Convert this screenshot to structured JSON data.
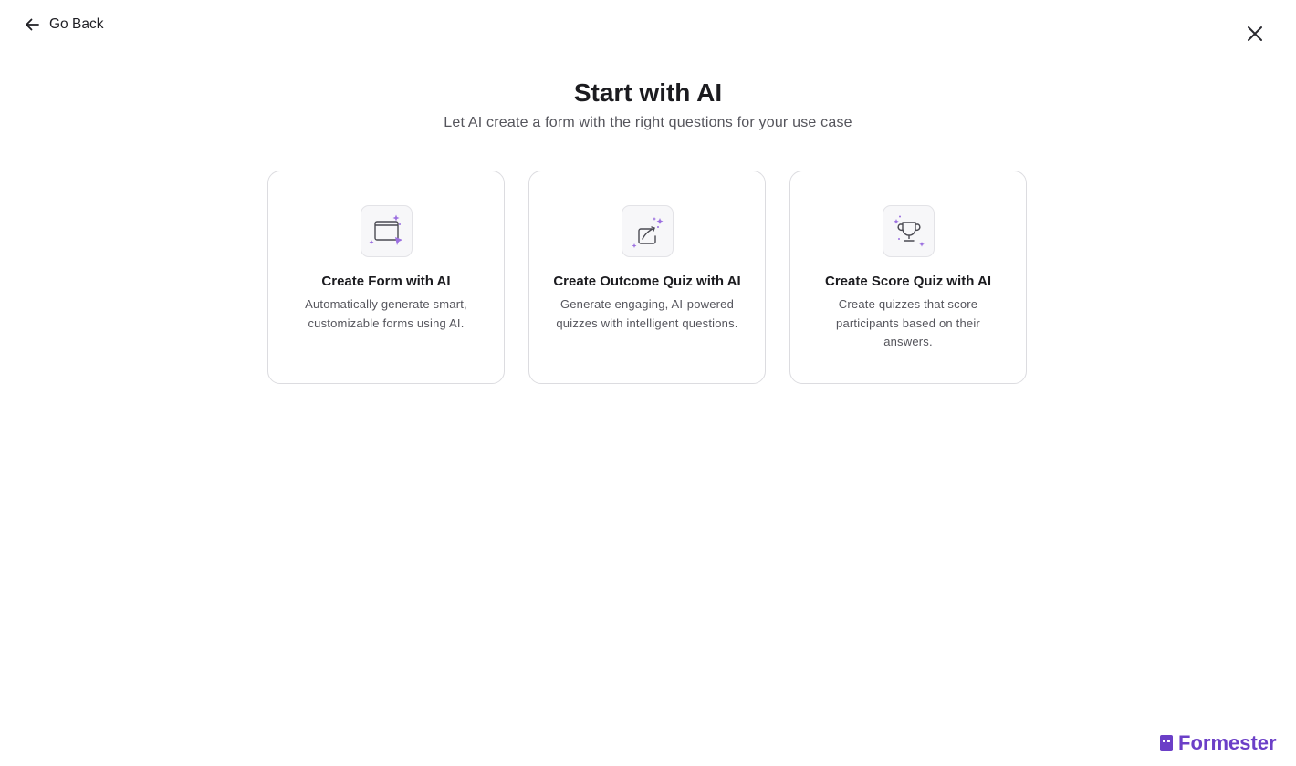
{
  "nav": {
    "back_label": "Go Back"
  },
  "header": {
    "title": "Start with AI",
    "subtitle": "Let AI create a form with the right questions for your use case"
  },
  "cards": [
    {
      "icon": "form-sparkle-icon",
      "title": "Create Form with AI",
      "description": "Automatically generate smart, customizable forms using AI."
    },
    {
      "icon": "outcome-quiz-icon",
      "title": "Create Outcome Quiz with AI",
      "description": "Generate engaging, AI-powered quizzes with intelligent questions."
    },
    {
      "icon": "trophy-icon",
      "title": "Create Score Quiz with AI",
      "description": "Create quizzes that score participants based on their answers."
    }
  ],
  "brand": {
    "name": "Formester"
  },
  "colors": {
    "accent": "#6b3fc7",
    "sparkle": "#9b6fe0",
    "text": "#1b1b1f",
    "muted": "#55555c",
    "border": "#dcdce0"
  }
}
